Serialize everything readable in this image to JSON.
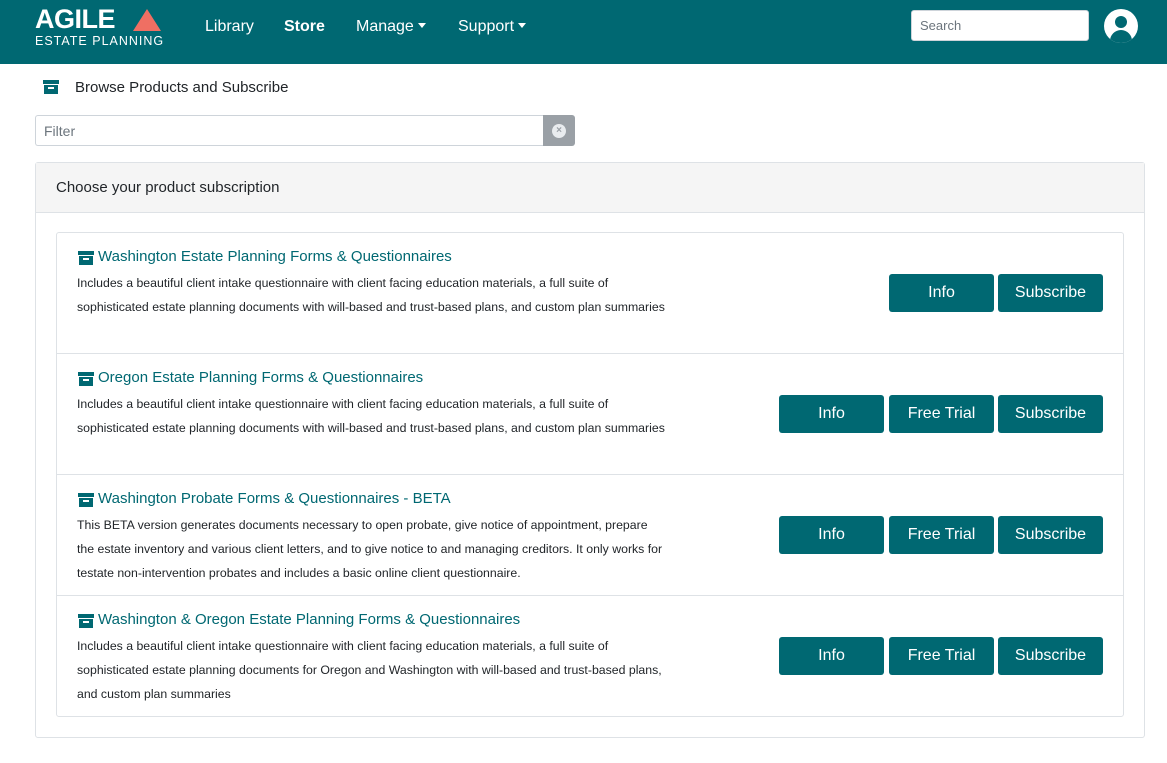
{
  "brand": {
    "name": "AGILE",
    "tagline": "ESTATE PLANNING",
    "accent": "#ef6f63",
    "primary": "#006872"
  },
  "nav": {
    "items": [
      {
        "label": "Library"
      },
      {
        "label": "Store",
        "active": true
      },
      {
        "label": "Manage",
        "dropdown": true
      },
      {
        "label": "Support",
        "dropdown": true
      }
    ],
    "search_placeholder": "Search",
    "user_icon": "user-circle-icon"
  },
  "page": {
    "heading": "Browse Products and Subscribe",
    "heading_icon": "archive-box-icon"
  },
  "filter": {
    "placeholder": "Filter",
    "value": "",
    "clear_icon": "clear-circle-icon"
  },
  "card": {
    "header": "Choose your product subscription"
  },
  "products": [
    {
      "title": "Washington Estate Planning Forms & Questionnaires",
      "description": "Includes a beautiful client intake questionnaire with client facing education materials, a full suite of sophisticated estate planning documents with will-based and trust-based plans, and custom plan summaries",
      "buttons": {
        "info": "Info",
        "subscribe": "Subscribe"
      }
    },
    {
      "title": "Oregon Estate Planning Forms & Questionnaires",
      "description": "Includes a beautiful client intake questionnaire with client facing education materials, a full suite of sophisticated estate planning documents with will-based and trust-based plans, and custom plan summaries",
      "buttons": {
        "info": "Info",
        "free_trial": "Free Trial",
        "subscribe": "Subscribe"
      }
    },
    {
      "title": "Washington Probate Forms & Questionnaires - BETA",
      "description": "This BETA version generates documents necessary to open probate, give notice of appointment, prepare the estate inventory and various client letters, and to give notice to and managing creditors. It only works for testate non-intervention probates and includes a basic online client questionnaire.",
      "buttons": {
        "info": "Info",
        "free_trial": "Free Trial",
        "subscribe": "Subscribe"
      }
    },
    {
      "title": "Washington & Oregon Estate Planning Forms & Questionnaires",
      "description": "Includes a beautiful client intake questionnaire with client facing education materials, a full suite of sophisticated estate planning documents for Oregon and Washington with will-based and trust-based plans, and custom plan summaries",
      "buttons": {
        "info": "Info",
        "free_trial": "Free Trial",
        "subscribe": "Subscribe"
      }
    }
  ]
}
